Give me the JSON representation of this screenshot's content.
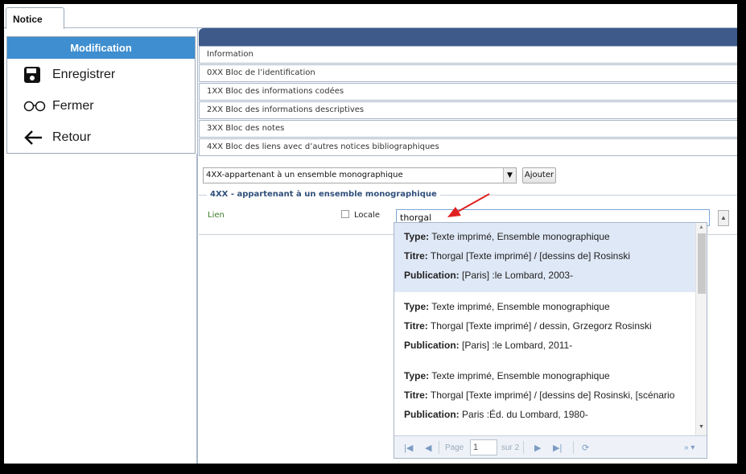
{
  "tabs": {
    "notice": "Notice"
  },
  "left_panel": {
    "header": "Modification",
    "items": [
      {
        "label": "Enregistrer",
        "icon": "save-icon"
      },
      {
        "label": "Fermer",
        "icon": "glasses-icon"
      },
      {
        "label": "Retour",
        "icon": "arrow-left-icon"
      }
    ]
  },
  "sections": [
    "Information",
    "0XX Bloc de l’identification",
    "1XX Bloc des informations codées",
    "2XX Bloc des informations descriptives",
    "3XX Bloc des notes",
    "4XX Bloc des liens avec d’autres notices bibliographiques"
  ],
  "add_block": {
    "selected": "4XX-appartenant à un ensemble monographique",
    "add_label": "Ajouter"
  },
  "fieldset": {
    "legend": "4XX - appartenant à un ensemble monographique",
    "lien_label": "Lien",
    "locale_label": "Locale",
    "locale_checked": false,
    "search_value": "thorgal"
  },
  "results": [
    {
      "type_label": "Type:",
      "type": "Texte imprimé, Ensemble monographique",
      "titre_label": "Titre:",
      "titre": "Thorgal [Texte imprimé] / [dessins de] Rosinski",
      "publication_label": "Publication:",
      "publication": "[Paris] :le Lombard, 2003-"
    },
    {
      "type_label": "Type:",
      "type": "Texte imprimé, Ensemble monographique",
      "titre_label": "Titre:",
      "titre": "Thorgal [Texte imprimé] / dessin, Grzegorz Rosinski",
      "publication_label": "Publication:",
      "publication": "[Paris] :le Lombard, 2011-"
    },
    {
      "type_label": "Type:",
      "type": "Texte imprimé, Ensemble monographique",
      "titre_label": "Titre:",
      "titre": "Thorgal [Texte imprimé] / [dessins de] Rosinski, [scénario",
      "publication_label": "Publication:",
      "publication": "Paris :Éd. du Lombard, 1980-"
    }
  ],
  "pager": {
    "page_label": "Page",
    "page_value": "1",
    "of_label": "sur 2",
    "more_label": "»"
  },
  "colors": {
    "accent": "#3e8ed0",
    "header_dark": "#3d5a8a",
    "selected_row": "#dfe8f6",
    "annotation_arrow": "#e02020"
  }
}
